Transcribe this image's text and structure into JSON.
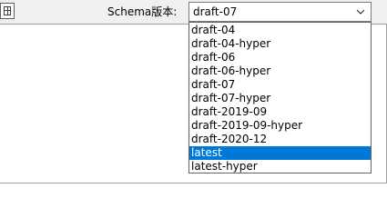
{
  "toolbar": {
    "schema_label": "Schema版本:",
    "select_value": "draft-07",
    "options": [
      {
        "label": "draft-04"
      },
      {
        "label": "draft-04-hyper"
      },
      {
        "label": "draft-06"
      },
      {
        "label": "draft-06-hyper"
      },
      {
        "label": "draft-07"
      },
      {
        "label": "draft-07-hyper"
      },
      {
        "label": "draft-2019-09"
      },
      {
        "label": "draft-2019-09-hyper"
      },
      {
        "label": "draft-2020-12"
      },
      {
        "label": "latest",
        "highlighted": true
      },
      {
        "label": "latest-hyper"
      }
    ]
  },
  "colors": {
    "highlight": "#0078d7",
    "toolbar_bg": "#f0f0f0"
  },
  "icons": {
    "left": "form-icon",
    "chevron": "chevron-down-icon"
  }
}
